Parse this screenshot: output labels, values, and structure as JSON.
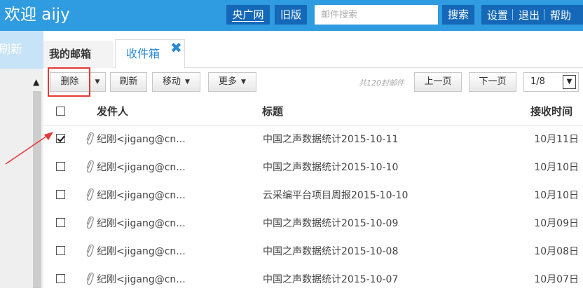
{
  "header": {
    "welcome": "欢迎 aijy",
    "cnr_label": "央广网",
    "old_version_label": "旧版",
    "search_placeholder": "邮件搜索",
    "search_button": "搜索",
    "settings": "设置",
    "logout": "退出",
    "help": "帮助"
  },
  "sidebar": {
    "refresh": "刷新"
  },
  "tabs": [
    {
      "label": "我的邮箱"
    },
    {
      "label": "收件箱",
      "active": true
    }
  ],
  "tab_close_icon": "✖",
  "toolbar": {
    "delete": "删除",
    "refresh": "刷新",
    "move": "移动",
    "more": "更多",
    "count_text": "共120封邮件",
    "prev": "上一页",
    "next": "下一页",
    "page": "1/8"
  },
  "table": {
    "headers": {
      "sender": "发件人",
      "subject": "标题",
      "time": "接收时间"
    },
    "rows": [
      {
        "checked": true,
        "sender": "纪刚<jigang@cn...",
        "subject": "中国之声数据统计2015-10-11",
        "date": "10月11日"
      },
      {
        "checked": false,
        "sender": "纪刚<jigang@cn...",
        "subject": "中国之声数据统计2015-10-10",
        "date": "10月10日"
      },
      {
        "checked": false,
        "sender": "纪刚<jigang@cn...",
        "subject": "云采编平台项目周报2015-10-10",
        "date": "10月10日"
      },
      {
        "checked": false,
        "sender": "纪刚<jigang@cn...",
        "subject": "中国之声数据统计2015-10-09",
        "date": "10月09日"
      },
      {
        "checked": false,
        "sender": "纪刚<jigang@cn...",
        "subject": "中国之声数据统计2015-10-08",
        "date": "10月08日"
      },
      {
        "checked": false,
        "sender": "纪刚<jigang@cn...",
        "subject": "中国之声数据统计2015-10-07",
        "date": "10月07日"
      }
    ]
  },
  "colors": {
    "header_bg": "#2f9be0",
    "header_button_bg": "#1568b7",
    "accent_tab": "#2a8ad8",
    "highlight_red": "#e53935"
  },
  "icons": {
    "attachment": "paperclip-icon",
    "caret": "caret-down-icon",
    "scroll_up": "scroll-up-arrow-icon",
    "close": "close-icon",
    "annotation": "red-arrow-icon"
  }
}
